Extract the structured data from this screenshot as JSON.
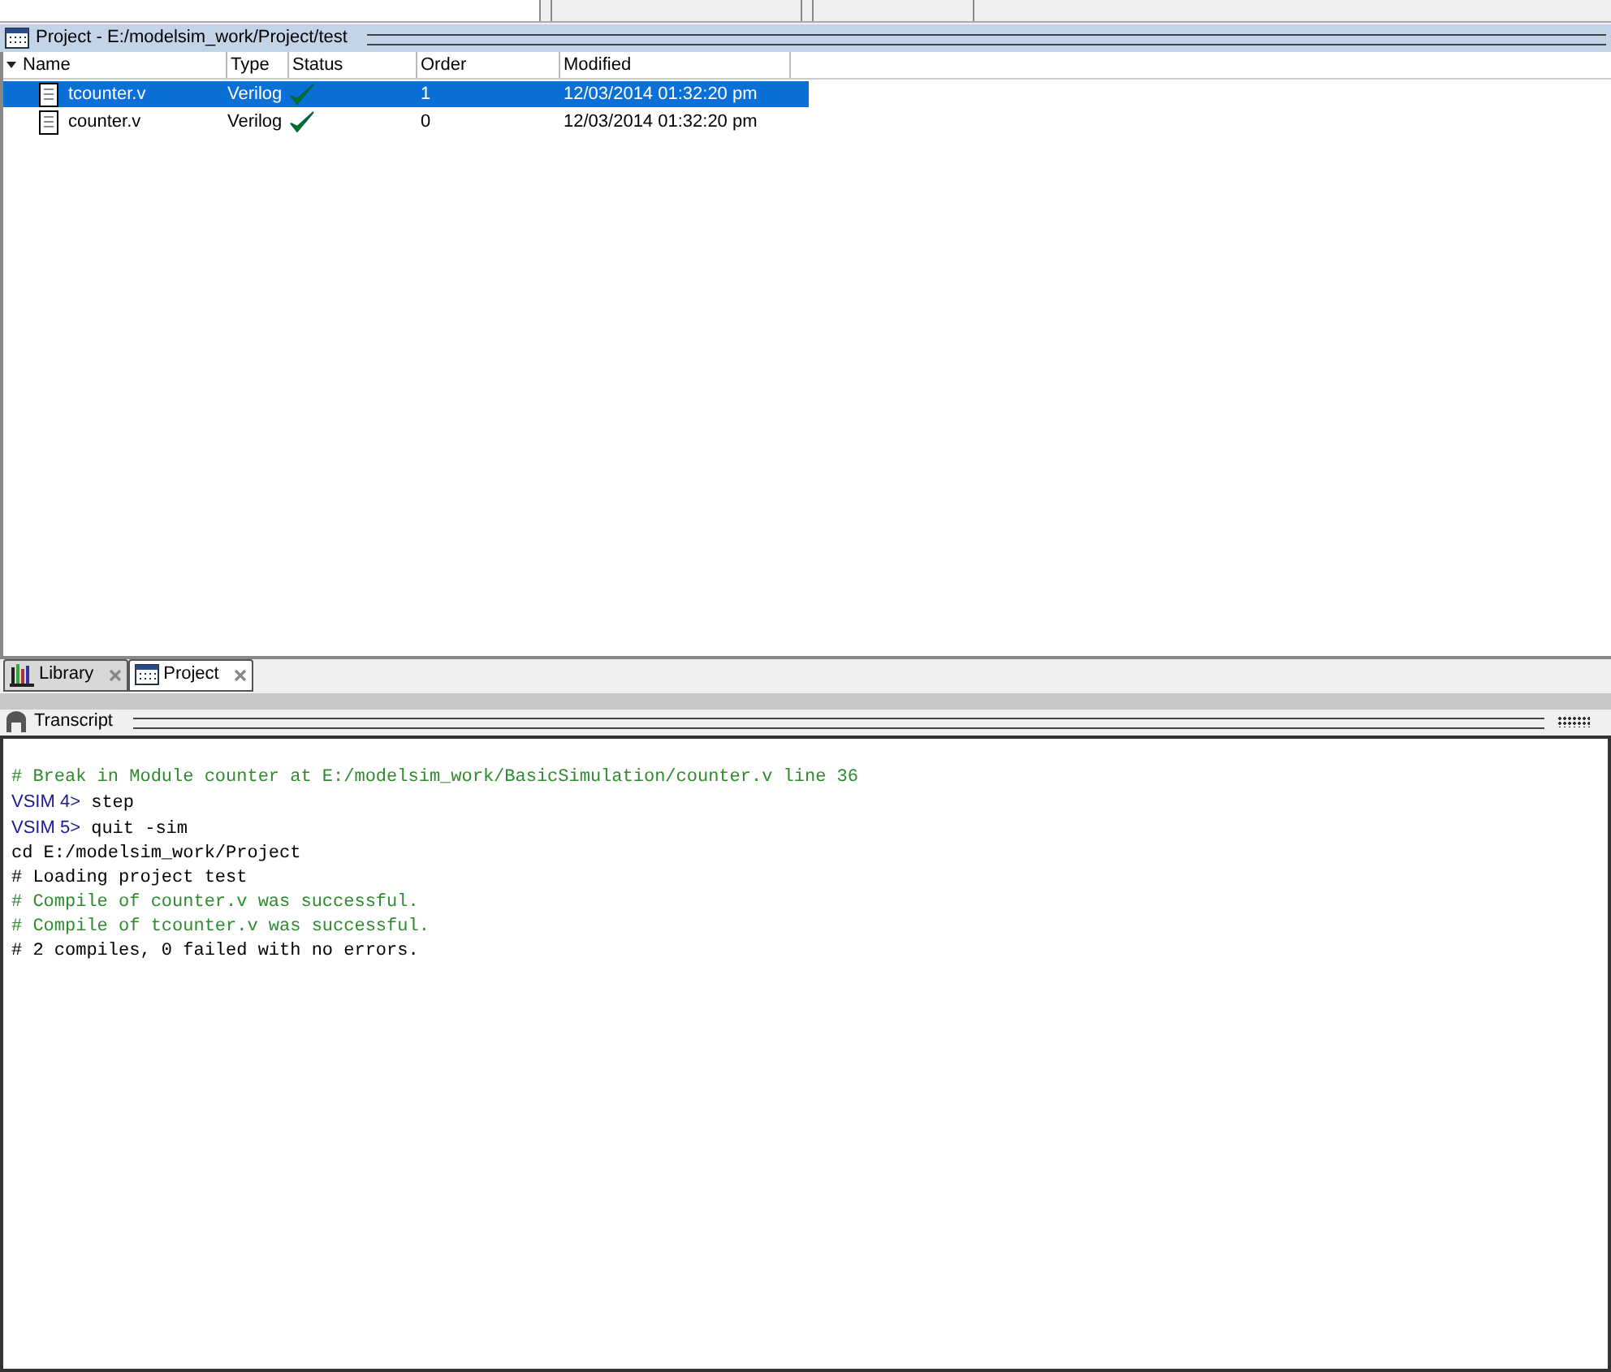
{
  "project_panel": {
    "title": "Project - E:/modelsim_work/Project/test"
  },
  "table": {
    "columns": [
      "Name",
      "Type",
      "Status",
      "Order",
      "Modified"
    ],
    "rows": [
      {
        "name": "tcounter.v",
        "type": "Verilog",
        "compiled": true,
        "order": "1",
        "modified": "12/03/2014 01:32:20 pm",
        "selected": true
      },
      {
        "name": "counter.v",
        "type": "Verilog",
        "compiled": true,
        "order": "0",
        "modified": "12/03/2014 01:32:20 pm",
        "selected": false
      }
    ]
  },
  "tabs": [
    {
      "label": "Library",
      "kind": "library",
      "selected": false
    },
    {
      "label": "Project",
      "kind": "project",
      "selected": true
    }
  ],
  "transcript": {
    "title": "Transcript",
    "lines": [
      {
        "kind": "comment",
        "text": "# Break in Module counter at E:/modelsim_work/BasicSimulation/counter.v line 36"
      },
      {
        "kind": "prompt",
        "prompt": "VSIM 4>",
        "text": " step"
      },
      {
        "kind": "prompt",
        "prompt": "VSIM 5>",
        "text": " quit -sim"
      },
      {
        "kind": "plain",
        "text": "cd E:/modelsim_work/Project"
      },
      {
        "kind": "plain",
        "text": "# Loading project test"
      },
      {
        "kind": "comment",
        "text": "# Compile of counter.v was successful."
      },
      {
        "kind": "comment",
        "text": "# Compile of tcounter.v was successful."
      },
      {
        "kind": "plain",
        "text": "# 2 compiles, 0 failed with no errors."
      }
    ]
  }
}
